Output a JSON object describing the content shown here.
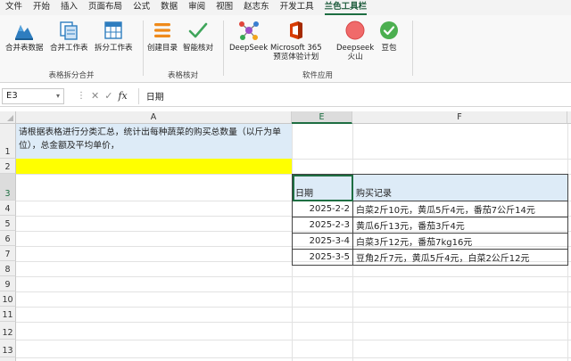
{
  "menu": {
    "tabs": [
      "文件",
      "开始",
      "插入",
      "页面布局",
      "公式",
      "数据",
      "审阅",
      "视图",
      "赵志东",
      "开发工具",
      "兰色工具栏"
    ],
    "active_tab": "兰色工具栏"
  },
  "ribbon": {
    "groups": [
      {
        "label": "表格拆分合并",
        "buttons": [
          {
            "label": "合并表数据",
            "icon": "merge-data-icon"
          },
          {
            "label": "合并工作表",
            "icon": "merge-sheets-icon"
          },
          {
            "label": "拆分工作表",
            "icon": "split-sheets-icon"
          }
        ]
      },
      {
        "label": "表格核对",
        "buttons": [
          {
            "label": "创建目录",
            "icon": "catalog-icon"
          },
          {
            "label": "智能核对",
            "icon": "checkmark-icon"
          }
        ]
      },
      {
        "label": "软件应用",
        "buttons": [
          {
            "label": "DeepSeek",
            "icon": "deepseek-icon"
          },
          {
            "label": "Microsoft 365",
            "label2": "预览体验计划",
            "icon": "microsoft365-icon"
          },
          {
            "label": "Deepseek",
            "label2": "火山",
            "icon": "deepseek-volcano-icon"
          },
          {
            "label": "豆包",
            "icon": "doubao-icon"
          }
        ]
      }
    ]
  },
  "formula_bar": {
    "name_box": "E3",
    "fx": "fx",
    "content": "日期"
  },
  "sheet": {
    "columns": [
      "A",
      "E",
      "F"
    ],
    "selected_column": "E",
    "rows": [
      "1",
      "2",
      "3",
      "4",
      "5",
      "6",
      "7",
      "8",
      "9",
      "10",
      "11",
      "12",
      "13"
    ],
    "selected_row": "3",
    "a1_text": "请根据表格进行分类汇总，统计出每种蔬菜的购买总数量（以斤为单位），总金额及平均单价，",
    "table": {
      "headers": [
        "日期",
        "购买记录"
      ],
      "rows": [
        [
          "2025-2-2",
          "白菜2斤10元，黄瓜5斤4元，番茄7公斤14元"
        ],
        [
          "2025-2-3",
          "黄瓜6斤13元，番茄3斤4元"
        ],
        [
          "2025-3-4",
          "白菜3斤12元，番茄7kg16元"
        ],
        [
          "2025-3-5",
          "豆角2斤7元，黄瓜5斤4元，白菜2公斤12元"
        ]
      ]
    }
  },
  "colors": {
    "accent": "#1e6e42",
    "header_fill": "#ddebf7",
    "highlight_fill": "#ffff00"
  }
}
